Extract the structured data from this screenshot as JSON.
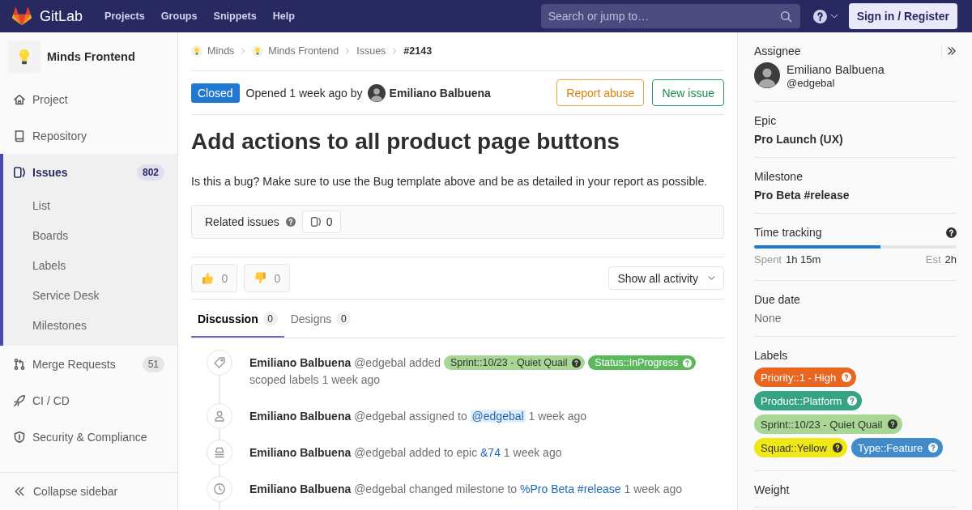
{
  "header": {
    "brand": "GitLab",
    "nav": [
      "Projects",
      "Groups",
      "Snippets",
      "Help"
    ],
    "search": {
      "placeholder": "Search or jump to…"
    },
    "sign_in": "Sign in / Register"
  },
  "sidebar": {
    "project": "Minds Frontend",
    "items": [
      {
        "label": "Project",
        "selected": false
      },
      {
        "label": "Repository",
        "selected": false
      },
      {
        "label": "Issues",
        "count": "802",
        "selected": true,
        "children": [
          {
            "label": "List",
            "selected": false
          },
          {
            "label": "Boards",
            "selected": false
          },
          {
            "label": "Labels",
            "selected": false
          },
          {
            "label": "Service Desk",
            "selected": false
          },
          {
            "label": "Milestones",
            "selected": false
          }
        ]
      },
      {
        "label": "Merge Requests",
        "count": "51",
        "selected": false
      },
      {
        "label": "CI / CD",
        "selected": false
      },
      {
        "label": "Security & Compliance",
        "selected": false
      }
    ],
    "collapse": "Collapse sidebar"
  },
  "breadcrumb": [
    {
      "label": "Minds",
      "kind": "group"
    },
    {
      "label": "Minds Frontend",
      "kind": "project"
    },
    {
      "label": "Issues",
      "kind": "link"
    },
    {
      "label": "#2143",
      "kind": "current"
    }
  ],
  "issue": {
    "status": {
      "label": "Closed",
      "kind": "closed"
    },
    "opened": "Opened 1 week ago by",
    "author": "Emiliano Balbuena",
    "actions": [
      {
        "label": "Report abuse",
        "kind": "warning"
      },
      {
        "label": "New issue",
        "kind": "success"
      }
    ],
    "title": "Add actions to all product page buttons",
    "description": "Is this a bug? Make sure to use the Bug template above and be as detailed in your report as possible.",
    "related": {
      "label": "Related issues",
      "count": "0"
    },
    "awards": [
      {
        "kind": "thumbsup",
        "count": "0"
      },
      {
        "kind": "thumbsdown",
        "count": "0"
      }
    ],
    "filter": "Show all activity",
    "tabs": [
      {
        "label": "Discussion",
        "count": "0",
        "selected": true
      },
      {
        "label": "Designs",
        "count": "0",
        "selected": false
      }
    ],
    "activity": [
      {
        "kind": "label",
        "author": "Emiliano Balbuena",
        "action": "@edgebal added",
        "labels": [
          {
            "name": "Sprint::10/23 - Quiet Quail",
            "color": "#a8d695"
          },
          {
            "name": "Status::InProgress",
            "color": "#5cb85c"
          }
        ],
        "after": "scoped labels 1 week ago"
      },
      {
        "kind": "assignee",
        "author": "Emiliano Balbuena",
        "action": "@edgebal assigned to",
        "link": "@edgebal",
        "after": "1 week ago"
      },
      {
        "kind": "epic",
        "author": "Emiliano Balbuena",
        "action": "@edgebal added to epic",
        "link": "&74",
        "after": "1 week ago"
      },
      {
        "kind": "milestone",
        "author": "Emiliano Balbuena",
        "action": "@edgebal changed milestone to",
        "link": "%Pro Beta #release",
        "after": "1 week ago"
      }
    ]
  },
  "right_sidebar": {
    "sections": [
      {
        "kind": "assignee",
        "title": "Assignee",
        "name": "Emiliano Balbuena",
        "username": "@edgebal"
      },
      {
        "kind": "value",
        "title": "Epic",
        "value": "Pro Launch (UX)"
      },
      {
        "kind": "value",
        "title": "Milestone",
        "value": "Pro Beta #release"
      },
      {
        "kind": "time",
        "title": "Time tracking",
        "level": 0.625,
        "spent_label": "Spent",
        "spent": "1h 15m",
        "estimate_label": "Est",
        "estimate": "2h"
      },
      {
        "kind": "empty",
        "title": "Due date",
        "value": "None"
      },
      {
        "kind": "labels",
        "title": "Labels",
        "labels": [
          {
            "name": "Priority::1 - High",
            "color": "#e8661f"
          },
          {
            "name": "Product::Platform",
            "color": "#36a484"
          },
          {
            "name": "Sprint::10/23 - Quiet Quail",
            "color": "#a8d695"
          },
          {
            "name": "Squad::Yellow",
            "color": "#f0e816"
          },
          {
            "name": "Type::Feature",
            "color": "#428bca"
          }
        ]
      },
      {
        "kind": "empty",
        "title": "Weight"
      }
    ]
  }
}
